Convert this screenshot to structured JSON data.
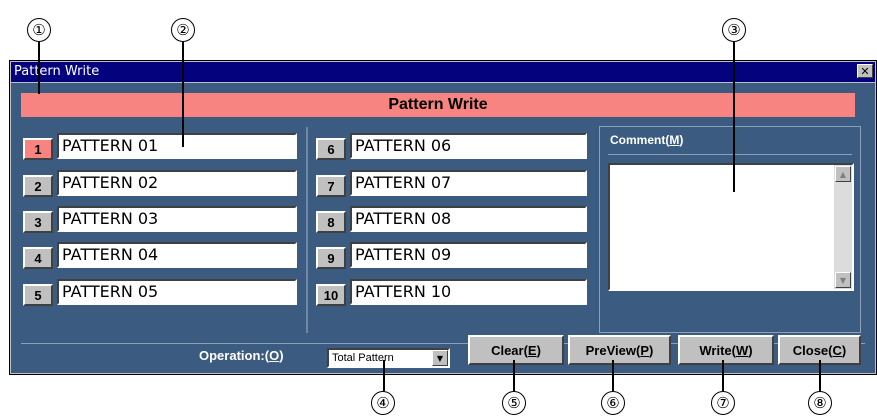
{
  "callouts": [
    "①",
    "②",
    "③",
    "④",
    "⑤",
    "⑥",
    "⑦",
    "⑧"
  ],
  "window": {
    "title": "Pattern Write",
    "close_glyph": "✕"
  },
  "header": {
    "title": "Pattern Write"
  },
  "patterns": [
    {
      "num": "1",
      "name": "PATTERN 01",
      "active": true
    },
    {
      "num": "2",
      "name": "PATTERN 02"
    },
    {
      "num": "3",
      "name": "PATTERN 03"
    },
    {
      "num": "4",
      "name": "PATTERN 04"
    },
    {
      "num": "5",
      "name": "PATTERN 05"
    },
    {
      "num": "6",
      "name": "PATTERN 06"
    },
    {
      "num": "7",
      "name": "PATTERN 07"
    },
    {
      "num": "8",
      "name": "PATTERN 08"
    },
    {
      "num": "9",
      "name": "PATTERN 09"
    },
    {
      "num": "10",
      "name": "PATTERN 10"
    }
  ],
  "comment": {
    "label_prefix": "Comment(",
    "label_key": "M",
    "label_suffix": ")"
  },
  "operation": {
    "label_prefix": "Operation:(",
    "label_key": "O",
    "label_suffix": ")",
    "selected": "Total Pattern"
  },
  "buttons": {
    "clear": {
      "prefix": "Clear(",
      "key": "E",
      "suffix": ")"
    },
    "preview": {
      "prefix": "PreView(",
      "key": "P",
      "suffix": ")"
    },
    "write": {
      "prefix": "Write(",
      "key": "W",
      "suffix": ")"
    },
    "close": {
      "prefix": "Close(",
      "key": "C",
      "suffix": ")"
    }
  },
  "colors": {
    "titlebar": "#04037d",
    "panel": "#3b5c80",
    "accent": "#f78481",
    "face": "#c0c0c0"
  }
}
